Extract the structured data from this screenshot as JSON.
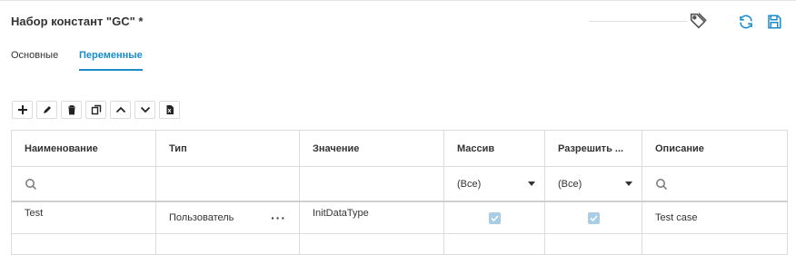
{
  "header": {
    "title": "Набор констант \"GC\" *"
  },
  "tabs": [
    {
      "label": "Основные"
    },
    {
      "label": "Переменные"
    }
  ],
  "table": {
    "columns": [
      "Наименование",
      "Тип",
      "Значение",
      "Массив",
      "Разрешить ...",
      "Описание"
    ],
    "filters": {
      "array": "(Все)",
      "allow": "(Все)"
    },
    "rows": [
      {
        "name": "Test",
        "type": "Пользователь",
        "value": "InitDataType",
        "array": true,
        "allow": true,
        "description": "Test case"
      }
    ]
  },
  "colors": {
    "accent": "#1a8cc9",
    "checkbox": "#a9cde6"
  }
}
